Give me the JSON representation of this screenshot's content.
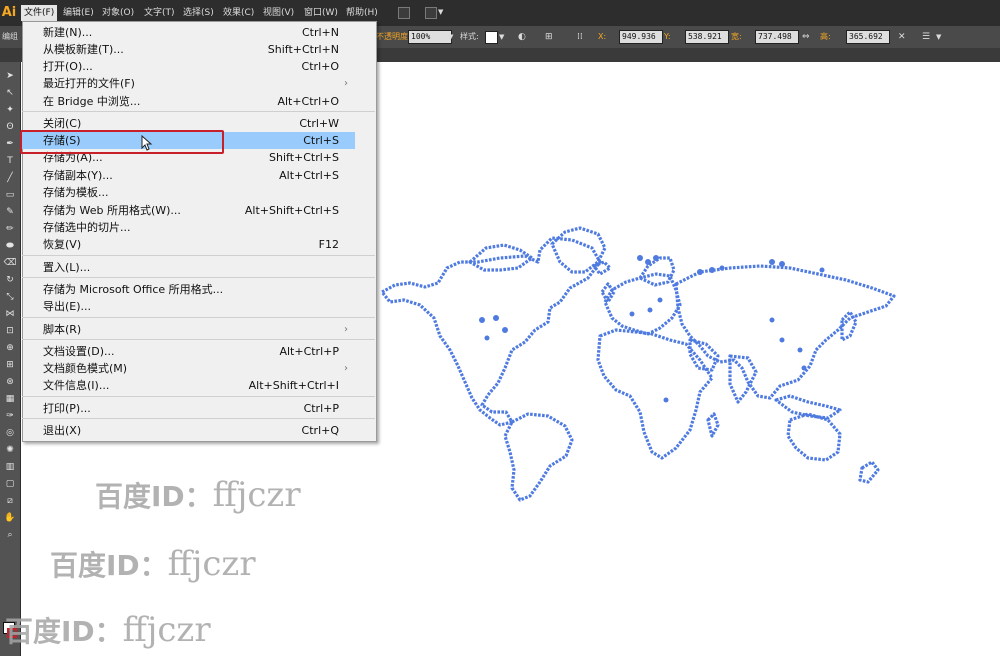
{
  "app": {
    "logo": "Ai"
  },
  "menubar": {
    "items": [
      {
        "label": "文件(F)",
        "active": true
      },
      {
        "label": "编辑(E)"
      },
      {
        "label": "对象(O)"
      },
      {
        "label": "文字(T)"
      },
      {
        "label": "选择(S)"
      },
      {
        "label": "效果(C)"
      },
      {
        "label": "视图(V)"
      },
      {
        "label": "窗口(W)"
      },
      {
        "label": "帮助(H)"
      }
    ]
  },
  "controlbar": {
    "left_label": "编组",
    "opacity_label": "不透明度",
    "opacity_value": "100%",
    "style_label": "样式:",
    "x_label": "X:",
    "x_value": "949.936",
    "y_label": "Y:",
    "y_value": "538.921",
    "width_label": "宽:",
    "width_value": "737.498",
    "height_label": "高:",
    "height_value": "365.692"
  },
  "file_menu": {
    "items": [
      {
        "label": "新建(N)...",
        "shortcut": "Ctrl+N"
      },
      {
        "label": "从模板新建(T)...",
        "shortcut": "Shift+Ctrl+N"
      },
      {
        "label": "打开(O)...",
        "shortcut": "Ctrl+O"
      },
      {
        "label": "最近打开的文件(F)",
        "shortcut": "",
        "submenu": true
      },
      {
        "label": "在 Bridge 中浏览...",
        "shortcut": "Alt+Ctrl+O"
      },
      {
        "label": "关闭(C)",
        "shortcut": "Ctrl+W"
      },
      {
        "label": "存储(S)",
        "shortcut": "Ctrl+S",
        "highlighted": true
      },
      {
        "label": "存储为(A)...",
        "shortcut": "Shift+Ctrl+S"
      },
      {
        "label": "存储副本(Y)...",
        "shortcut": "Alt+Ctrl+S"
      },
      {
        "label": "存储为模板...",
        "shortcut": ""
      },
      {
        "label": "存储为 Web 所用格式(W)...",
        "shortcut": "Alt+Shift+Ctrl+S"
      },
      {
        "label": "存储选中的切片...",
        "shortcut": ""
      },
      {
        "label": "恢复(V)",
        "shortcut": "F12"
      },
      {
        "label": "置入(L)...",
        "shortcut": ""
      },
      {
        "label": "存储为 Microsoft Office 所用格式...",
        "shortcut": ""
      },
      {
        "label": "导出(E)...",
        "shortcut": ""
      },
      {
        "label": "脚本(R)",
        "shortcut": "",
        "submenu": true
      },
      {
        "label": "文档设置(D)...",
        "shortcut": "Alt+Ctrl+P"
      },
      {
        "label": "文档颜色模式(M)",
        "shortcut": "",
        "submenu": true
      },
      {
        "label": "文件信息(I)...",
        "shortcut": "Alt+Shift+Ctrl+I"
      },
      {
        "label": "打印(P)...",
        "shortcut": "Ctrl+P"
      },
      {
        "label": "退出(X)",
        "shortcut": "Ctrl+Q"
      }
    ]
  },
  "watermark": {
    "brand": "百度ID：",
    "user": "ffjczr"
  },
  "colors": {
    "menu_highlight": "#99ccfc",
    "annotation_red": "#c8202a",
    "map_dots": "#4f7be0",
    "accent_orange": "#f7a823"
  },
  "icons": {
    "tools": [
      "selection-tool-icon",
      "direct-selection-icon",
      "magic-wand-icon",
      "lasso-icon",
      "pen-tool-icon",
      "type-tool-icon",
      "line-tool-icon",
      "rectangle-tool-icon",
      "paintbrush-icon",
      "pencil-icon",
      "blob-brush-icon",
      "eraser-icon",
      "rotate-icon",
      "scale-icon",
      "width-tool-icon",
      "free-transform-icon",
      "shape-builder-icon",
      "perspective-grid-icon",
      "mesh-icon",
      "gradient-icon",
      "eyedropper-icon",
      "blend-icon",
      "symbol-sprayer-icon",
      "column-graph-icon",
      "artboard-icon",
      "slice-icon",
      "hand-tool-icon",
      "zoom-tool-icon"
    ]
  }
}
